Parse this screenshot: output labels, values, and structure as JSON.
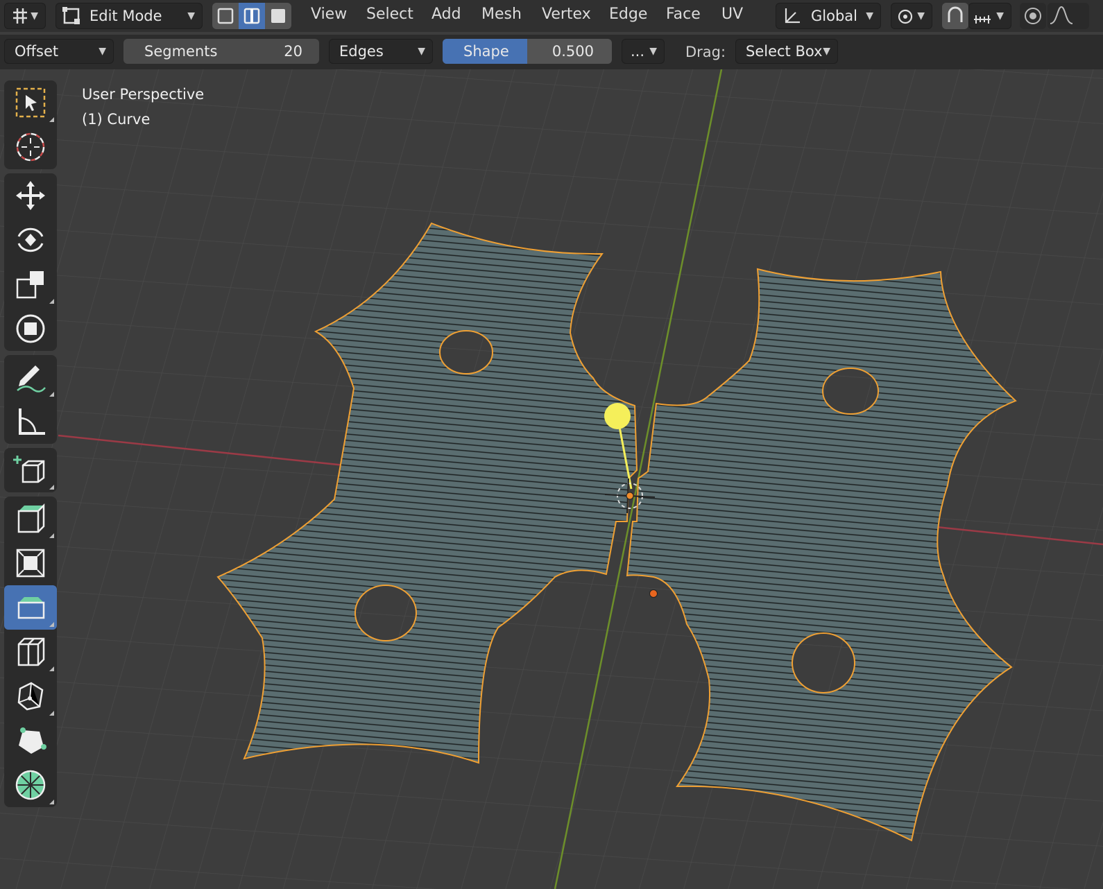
{
  "header": {
    "mode": "Edit Mode",
    "menus": [
      "View",
      "Select",
      "Add",
      "Mesh",
      "Vertex",
      "Edge",
      "Face",
      "UV"
    ],
    "orientation": "Global"
  },
  "toolbar": {
    "offset_type": "Offset",
    "segments_label": "Segments",
    "segments_value": "20",
    "affect": "Edges",
    "shape_label": "Shape",
    "shape_value": "0.500",
    "more": "...",
    "drag_label": "Drag:",
    "drag_value": "Select Box"
  },
  "viewport": {
    "view_name": "User Perspective",
    "object_name": "(1) Curve"
  },
  "tools": [
    "select-box",
    "cursor",
    "move",
    "rotate",
    "scale",
    "transform",
    "annotate",
    "measure",
    "add-cube",
    "extrude-region",
    "inset-faces",
    "bevel",
    "loop-cut",
    "knife",
    "poly-build",
    "spin"
  ],
  "colors": {
    "accent": "#4772b3",
    "mesh_fill": "#5a6d70",
    "outline": "#e8922a",
    "x_axis": "#9b3a46",
    "y_axis": "#6d8f2a",
    "handle": "#f5ef5a"
  }
}
